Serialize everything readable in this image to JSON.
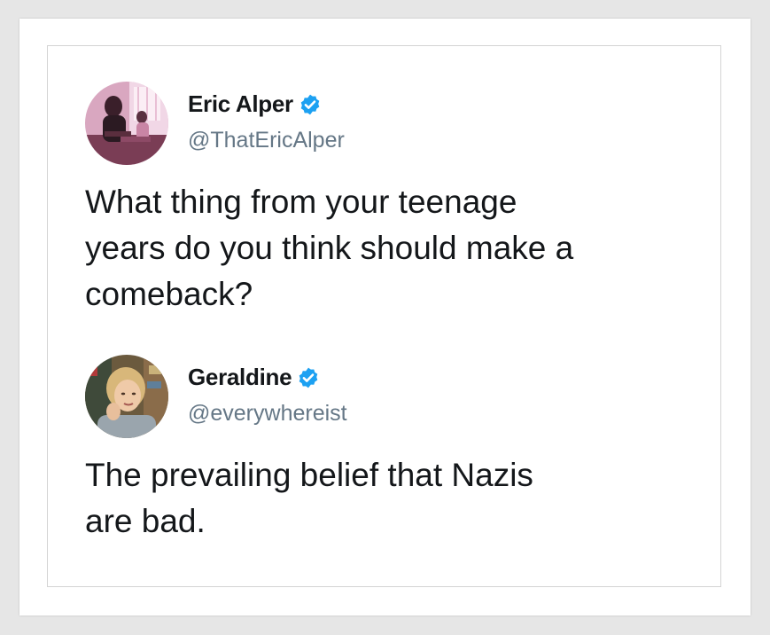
{
  "tweets": [
    {
      "display_name": "Eric Alper",
      "handle": "@ThatEricAlper",
      "verified": true,
      "avatar_icon": "avatar-photo-musicians",
      "text_lines": [
        "What thing from your teenage",
        "years do you think should make a",
        "comeback?"
      ]
    },
    {
      "display_name": "Geraldine",
      "handle": "@everywhereist",
      "verified": true,
      "avatar_icon": "avatar-photo-woman",
      "text_lines": [
        "The prevailing belief that Nazis",
        "are bad."
      ]
    }
  ],
  "colors": {
    "name": "#14171a",
    "handle": "#657786",
    "text": "#14171a",
    "verified": "#1da1f2",
    "background": "#e6e6e6",
    "card": "#ffffff"
  }
}
